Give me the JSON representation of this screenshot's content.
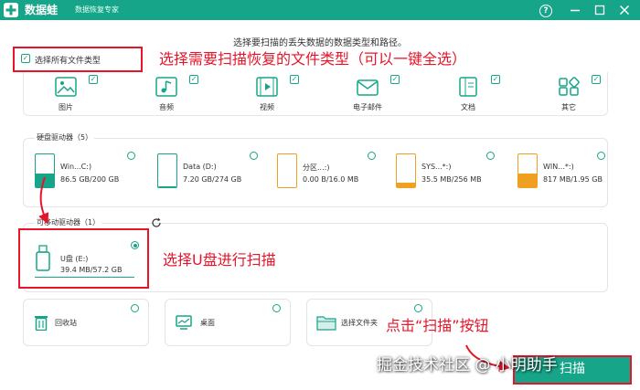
{
  "app": {
    "brand": "数据蛙",
    "subtitle": "数据恢复专家",
    "accent_color": "#16a589",
    "annotation_color": "#e8142a"
  },
  "titlebar_icons": [
    "help-icon",
    "minimize-icon",
    "maximize-icon",
    "close-icon"
  ],
  "instruction": "选择要扫描的丢失数据的数据类型和路径。",
  "select_all": {
    "label": "选择所有文件类型",
    "checked": true
  },
  "file_types": [
    {
      "label": "图片",
      "icon": "image-icon",
      "checked": true
    },
    {
      "label": "音频",
      "icon": "audio-icon",
      "checked": true
    },
    {
      "label": "视频",
      "icon": "video-icon",
      "checked": true
    },
    {
      "label": "电子邮件",
      "icon": "email-icon",
      "checked": true
    },
    {
      "label": "文档",
      "icon": "document-icon",
      "checked": true
    },
    {
      "label": "其它",
      "icon": "other-icon",
      "checked": true
    }
  ],
  "hard_drives": {
    "title": "硬盘驱动器（5）",
    "items": [
      {
        "name": "Win...C:)",
        "size": "86.5 GB/200 GB",
        "used_fraction": 0.43,
        "selected": false
      },
      {
        "name": "Data (D:)",
        "size": "7.20 GB/274 GB",
        "used_fraction": 0.03,
        "selected": false
      },
      {
        "name": "分区...:)",
        "size": "0.00 B/16.0 MB",
        "used_fraction": 0.0,
        "selected": false
      },
      {
        "name": "SYS...*:)",
        "size": "35.5 MB/256 MB",
        "used_fraction": 0.14,
        "selected": false
      },
      {
        "name": "WIN...*:)",
        "size": "817 MB/1.95 GB",
        "used_fraction": 0.42,
        "selected": false
      }
    ]
  },
  "removable": {
    "title": "可移动驱动器（1）",
    "refresh_icon": "refresh-icon",
    "items": [
      {
        "name": "U盘 (E:)",
        "size": "39.4 MB/57.2 GB",
        "selected": true
      }
    ]
  },
  "locations": [
    {
      "label": "回收站",
      "icon": "trash-icon"
    },
    {
      "label": "桌面",
      "icon": "desktop-icon"
    },
    {
      "label": "选择文件夹",
      "icon": "folder-icon"
    }
  ],
  "scan_button": {
    "label": "扫描"
  },
  "annotations": {
    "select_types": "选择需要扫描恢复的文件类型（可以一键全选）",
    "select_usb": "选择U盘进行扫描",
    "click_scan": "点击“扫描”按钮"
  },
  "watermark": "掘金技术社区 @ 小明助手"
}
